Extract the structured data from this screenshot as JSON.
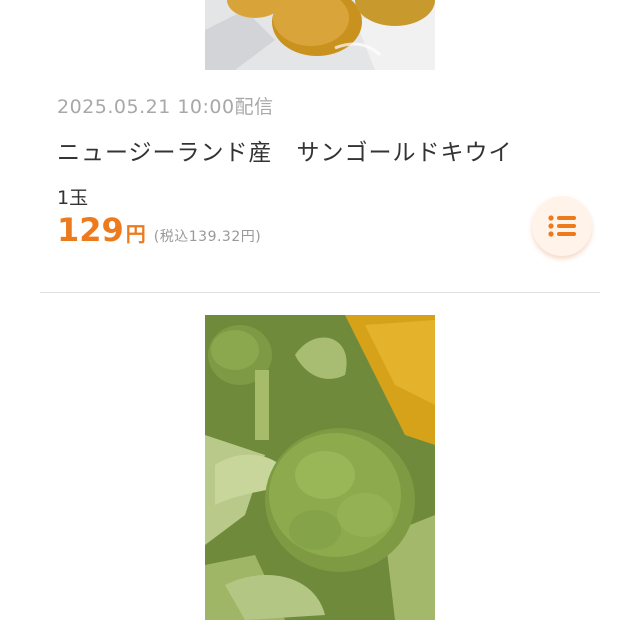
{
  "item1": {
    "image_label": "kiwi-photo",
    "date": "2025.05.21 10:00配信",
    "title": "ニュージーランド産　サンゴールドキウイ",
    "quantity": "1玉",
    "price": "129",
    "price_unit": "円",
    "price_tax": "(税込139.32円)"
  },
  "item2": {
    "image_label": "broccoli-photo"
  },
  "colors": {
    "accent": "#ed7a1c",
    "date_text": "#a8a8a8",
    "divider": "#e0e0e0",
    "button_bg": "#fff3ea"
  },
  "icons": {
    "list_button": "list-icon"
  }
}
